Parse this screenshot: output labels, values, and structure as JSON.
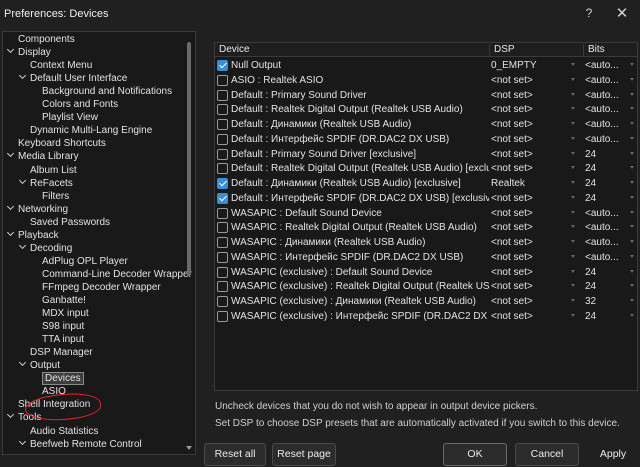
{
  "window": {
    "title": "Preferences: Devices",
    "help_glyph": "?",
    "close_glyph": "✕"
  },
  "tree": [
    {
      "label": "Components",
      "indent": 0,
      "expanded": null
    },
    {
      "label": "Display",
      "indent": 0,
      "expanded": true
    },
    {
      "label": "Context Menu",
      "indent": 1,
      "expanded": null
    },
    {
      "label": "Default User Interface",
      "indent": 1,
      "expanded": true
    },
    {
      "label": "Background and Notifications",
      "indent": 2,
      "expanded": null
    },
    {
      "label": "Colors and Fonts",
      "indent": 2,
      "expanded": null
    },
    {
      "label": "Playlist View",
      "indent": 2,
      "expanded": null
    },
    {
      "label": "Dynamic Multi-Lang Engine",
      "indent": 1,
      "expanded": null
    },
    {
      "label": "Keyboard Shortcuts",
      "indent": 0,
      "expanded": null
    },
    {
      "label": "Media Library",
      "indent": 0,
      "expanded": true
    },
    {
      "label": "Album List",
      "indent": 1,
      "expanded": null
    },
    {
      "label": "ReFacets",
      "indent": 1,
      "expanded": true
    },
    {
      "label": "Filters",
      "indent": 2,
      "expanded": null
    },
    {
      "label": "Networking",
      "indent": 0,
      "expanded": true
    },
    {
      "label": "Saved Passwords",
      "indent": 1,
      "expanded": null
    },
    {
      "label": "Playback",
      "indent": 0,
      "expanded": true
    },
    {
      "label": "Decoding",
      "indent": 1,
      "expanded": true
    },
    {
      "label": "AdPlug OPL Player",
      "indent": 2,
      "expanded": null
    },
    {
      "label": "Command-Line Decoder Wrapper",
      "indent": 2,
      "expanded": null
    },
    {
      "label": "FFmpeg Decoder Wrapper",
      "indent": 2,
      "expanded": null
    },
    {
      "label": "Ganbatte!",
      "indent": 2,
      "expanded": null
    },
    {
      "label": "MDX input",
      "indent": 2,
      "expanded": null
    },
    {
      "label": "S98 input",
      "indent": 2,
      "expanded": null
    },
    {
      "label": "TTA input",
      "indent": 2,
      "expanded": null
    },
    {
      "label": "DSP Manager",
      "indent": 1,
      "expanded": null
    },
    {
      "label": "Output",
      "indent": 1,
      "expanded": true
    },
    {
      "label": "Devices",
      "indent": 2,
      "expanded": null,
      "selected": true
    },
    {
      "label": "ASIO",
      "indent": 2,
      "expanded": null
    },
    {
      "label": "Shell Integration",
      "indent": 0,
      "expanded": null
    },
    {
      "label": "Tools",
      "indent": 0,
      "expanded": true
    },
    {
      "label": "Audio Statistics",
      "indent": 1,
      "expanded": null
    },
    {
      "label": "Beefweb Remote Control",
      "indent": 1,
      "expanded": true
    }
  ],
  "table": {
    "headers": {
      "device": "Device",
      "dsp": "DSP",
      "bits": "Bits"
    },
    "rows": [
      {
        "checked": true,
        "device": "Null Output",
        "dsp": "0_EMPTY",
        "bits": "<auto..."
      },
      {
        "checked": false,
        "device": "ASIO : Realtek ASIO",
        "dsp": "<not set>",
        "bits": "<auto..."
      },
      {
        "checked": false,
        "device": "Default : Primary Sound Driver",
        "dsp": "<not set>",
        "bits": "<auto..."
      },
      {
        "checked": false,
        "device": "Default : Realtek Digital Output (Realtek USB Audio)",
        "dsp": "<not set>",
        "bits": "<auto..."
      },
      {
        "checked": false,
        "device": "Default : Динамики (Realtek USB Audio)",
        "dsp": "<not set>",
        "bits": "<auto..."
      },
      {
        "checked": false,
        "device": "Default : Интерфейс SPDIF (DR.DAC2 DX USB)",
        "dsp": "<not set>",
        "bits": "<auto..."
      },
      {
        "checked": false,
        "device": "Default : Primary Sound Driver [exclusive]",
        "dsp": "<not set>",
        "bits": "24"
      },
      {
        "checked": false,
        "device": "Default : Realtek Digital Output (Realtek USB Audio) [exclusive]",
        "dsp": "<not set>",
        "bits": "24"
      },
      {
        "checked": true,
        "device": "Default : Динамики (Realtek USB Audio) [exclusive]",
        "dsp": "Realtek",
        "bits": "24"
      },
      {
        "checked": true,
        "device": "Default : Интерфейс SPDIF (DR.DAC2 DX USB) [exclusive]",
        "dsp": "<not set>",
        "bits": "24"
      },
      {
        "checked": false,
        "device": "WASAPIC : Default Sound Device",
        "dsp": "<not set>",
        "bits": "<auto..."
      },
      {
        "checked": false,
        "device": "WASAPIC : Realtek Digital Output (Realtek USB Audio)",
        "dsp": "<not set>",
        "bits": "<auto..."
      },
      {
        "checked": false,
        "device": "WASAPIC : Динамики (Realtek USB Audio)",
        "dsp": "<not set>",
        "bits": "<auto..."
      },
      {
        "checked": false,
        "device": "WASAPIC : Интерфейс SPDIF (DR.DAC2 DX USB)",
        "dsp": "<not set>",
        "bits": "<auto..."
      },
      {
        "checked": false,
        "device": "WASAPIC (exclusive) : Default Sound Device",
        "dsp": "<not set>",
        "bits": "24"
      },
      {
        "checked": false,
        "device": "WASAPIC (exclusive) : Realtek Digital Output (Realtek USB Audio)",
        "dsp": "<not set>",
        "bits": "24"
      },
      {
        "checked": false,
        "device": "WASAPIC (exclusive) : Динамики (Realtek USB Audio)",
        "dsp": "<not set>",
        "bits": "32"
      },
      {
        "checked": false,
        "device": "WASAPIC (exclusive) : Интерфейс SPDIF (DR.DAC2 DX USB)",
        "dsp": "<not set>",
        "bits": "24"
      }
    ]
  },
  "help_lines": [
    "Uncheck devices that you do not wish to appear in output device pickers.",
    "Set DSP to choose DSP presets that are automatically activated if you switch to this device."
  ],
  "buttons": {
    "reset_all": "Reset all",
    "reset_page": "Reset page",
    "ok": "OK",
    "cancel": "Cancel",
    "apply": "Apply"
  },
  "colors": {
    "accent": "#3a8ed8",
    "annotation": "#e8262a"
  }
}
